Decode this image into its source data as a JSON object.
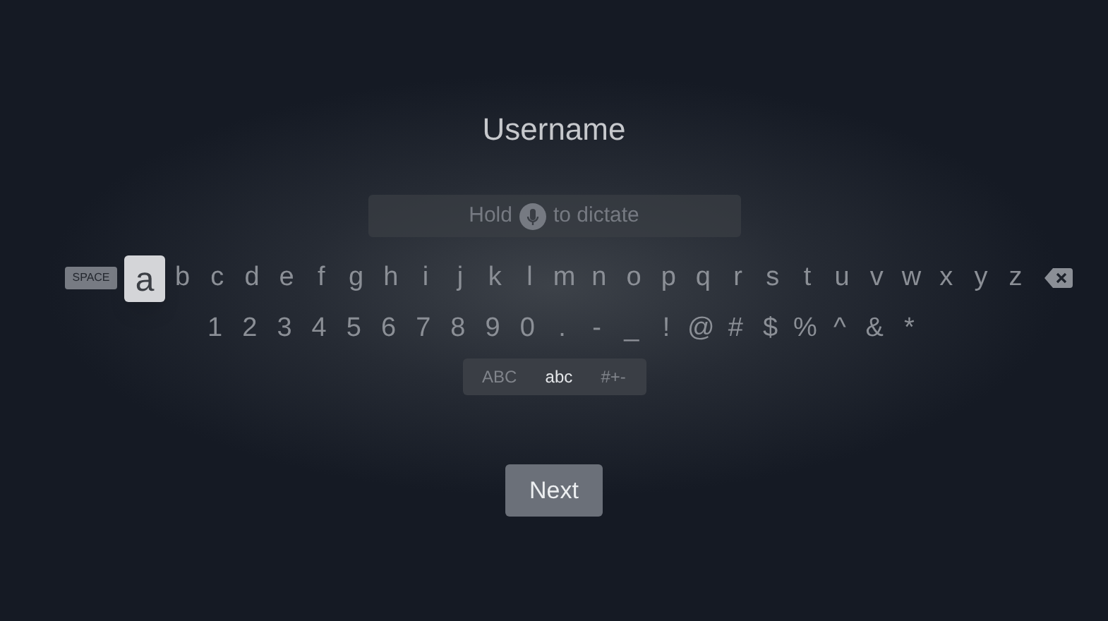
{
  "title": "Username",
  "dictation_field": {
    "placeholder_before": "Hold",
    "placeholder_after": "to dictate"
  },
  "space_key": "SPACE",
  "letter_keys": [
    {
      "label": "a",
      "selected": true
    },
    {
      "label": "b",
      "selected": false
    },
    {
      "label": "c",
      "selected": false
    },
    {
      "label": "d",
      "selected": false
    },
    {
      "label": "e",
      "selected": false
    },
    {
      "label": "f",
      "selected": false
    },
    {
      "label": "g",
      "selected": false
    },
    {
      "label": "h",
      "selected": false
    },
    {
      "label": "i",
      "selected": false
    },
    {
      "label": "j",
      "selected": false
    },
    {
      "label": "k",
      "selected": false
    },
    {
      "label": "l",
      "selected": false
    },
    {
      "label": "m",
      "selected": false
    },
    {
      "label": "n",
      "selected": false
    },
    {
      "label": "o",
      "selected": false
    },
    {
      "label": "p",
      "selected": false
    },
    {
      "label": "q",
      "selected": false
    },
    {
      "label": "r",
      "selected": false
    },
    {
      "label": "s",
      "selected": false
    },
    {
      "label": "t",
      "selected": false
    },
    {
      "label": "u",
      "selected": false
    },
    {
      "label": "v",
      "selected": false
    },
    {
      "label": "w",
      "selected": false
    },
    {
      "label": "x",
      "selected": false
    },
    {
      "label": "y",
      "selected": false
    },
    {
      "label": "z",
      "selected": false
    }
  ],
  "symbol_keys": [
    "1",
    "2",
    "3",
    "4",
    "5",
    "6",
    "7",
    "8",
    "9",
    "0",
    ".",
    "-",
    "_",
    "!",
    "@",
    "#",
    "$",
    "%",
    "^",
    "&",
    "*"
  ],
  "modes": [
    {
      "label": "ABC",
      "selected": false
    },
    {
      "label": "abc",
      "selected": true
    },
    {
      "label": "#+-",
      "selected": false
    }
  ],
  "next_button": "Next"
}
